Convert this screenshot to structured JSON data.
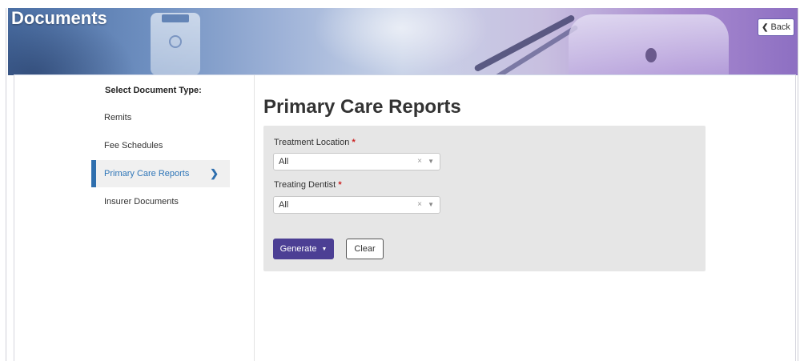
{
  "header": {
    "title": "Documents",
    "back_label": "Back"
  },
  "sidebar": {
    "heading": "Select Document Type:",
    "items": [
      {
        "label": "Remits",
        "active": false
      },
      {
        "label": "Fee Schedules",
        "active": false
      },
      {
        "label": "Primary Care Reports",
        "active": true
      },
      {
        "label": "Insurer Documents",
        "active": false
      }
    ]
  },
  "main": {
    "title": "Primary Care Reports",
    "fields": [
      {
        "label": "Treatment Location",
        "required_mark": "*",
        "value": "All"
      },
      {
        "label": "Treating Dentist",
        "required_mark": "*",
        "value": "All"
      }
    ],
    "generate_label": "Generate",
    "clear_label": "Clear"
  },
  "icons": {
    "back": "chevron-left-icon",
    "active_item": "chevron-right-icon",
    "select_clear": "clear-x-icon",
    "select_caret": "caret-down-icon",
    "generate_caret": "caret-down-icon"
  },
  "colors": {
    "primary_button": "#4c3f94",
    "active_item_text": "#2f76b8",
    "active_item_bar": "#2f6fae",
    "required": "#cc2222"
  }
}
